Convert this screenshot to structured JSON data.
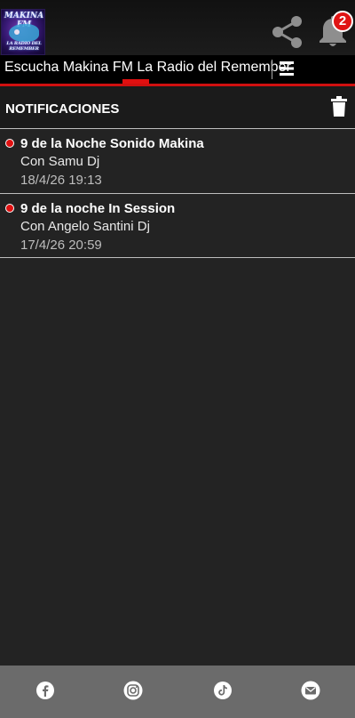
{
  "header": {
    "logo_text_top": "MAKINA FM",
    "logo_text_bottom": "LA RADIO DEL REMEMBER",
    "notification_count": "2",
    "icons": [
      "share-icon",
      "bell-icon"
    ]
  },
  "nav": {
    "title": "Escucha Makina FM La Radio del Remember",
    "menu_icon": "hamburger-menu-icon"
  },
  "notifications_section": {
    "title": "NOTIFICACIONES",
    "delete_icon": "trash-icon"
  },
  "notifications": [
    {
      "title": "9 de la Noche Sonido Makina",
      "subtitle": "Con Samu Dj",
      "date": "18/4/26 19:13",
      "unread": true
    },
    {
      "title": "9 de la noche In Session",
      "subtitle": "Con Angelo Santini Dj",
      "date": "17/4/26 20:59",
      "unread": true
    }
  ],
  "bottom_bar": {
    "icons": [
      "facebook-icon",
      "instagram-icon",
      "tiktok-icon",
      "email-icon"
    ]
  },
  "colors": {
    "accent": "#d01010",
    "background": "#232323",
    "bottom_bar": "#6b6b6b"
  }
}
